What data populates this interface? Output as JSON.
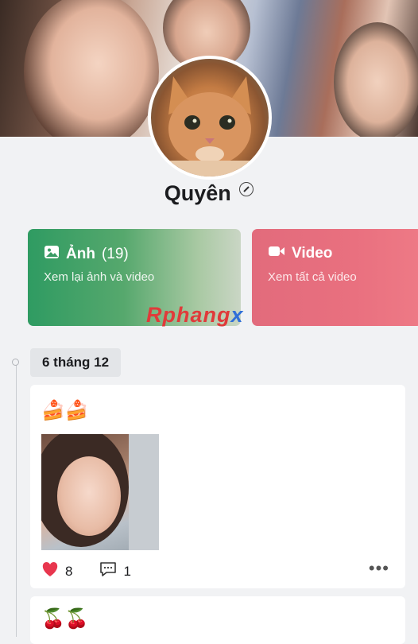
{
  "profile": {
    "name": "Quyên"
  },
  "cards": {
    "photos": {
      "title": "Ảnh",
      "count": "(19)",
      "subtitle": "Xem lại ảnh và video"
    },
    "videos": {
      "title": "Video",
      "subtitle": "Xem tất cả video"
    }
  },
  "watermark": {
    "part1": "Rphang",
    "part2": "x"
  },
  "timeline": {
    "date": "6 tháng 12"
  },
  "posts": [
    {
      "emoji": "🍰🍰",
      "likes": "8",
      "comments": "1",
      "more": "•••"
    },
    {
      "emoji": "🍒🍒"
    }
  ],
  "icons": [
    "pencil-icon",
    "image-icon",
    "video-camera-icon",
    "heart-icon",
    "comment-icon",
    "more-options-icon"
  ],
  "colors": {
    "photos_card": "#2f9b62",
    "videos_card": "#e26b7c",
    "like": "#e8364e",
    "watermark_red": "#e03a3a",
    "watermark_blue": "#2f6fd8"
  }
}
